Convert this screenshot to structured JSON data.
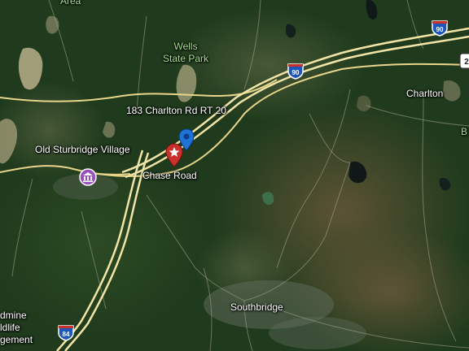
{
  "labels": {
    "area_partial": "Area",
    "wells_park": "Wells\nState Park",
    "address": "183 Charlton Rd RT 20",
    "old_sturbridge": "Old Sturbridge Village",
    "chase_road": "Chase Road",
    "charlton": "Charlton",
    "southbridge": "Southbridge",
    "left_bottom_partial": "dmine\nldlife\ngement",
    "right_edge_partial": "B"
  },
  "shields": {
    "i90_top": "90",
    "i90_mid": "90",
    "i84": "84",
    "right_edge": "2"
  },
  "colors": {
    "forest": "#1f3a1c",
    "road": "#e8d58c",
    "highway": "#f2e4a6",
    "pin_red": "#c9302c",
    "pin_blue": "#1e74d6",
    "poi_purple": "#9a4fc0",
    "interstate_blue": "#1f57b8",
    "park_label": "#a7df8f"
  },
  "icons": {
    "red_pin": "star-pin-icon",
    "blue_pin": "location-pin-icon",
    "poi": "museum-icon"
  }
}
